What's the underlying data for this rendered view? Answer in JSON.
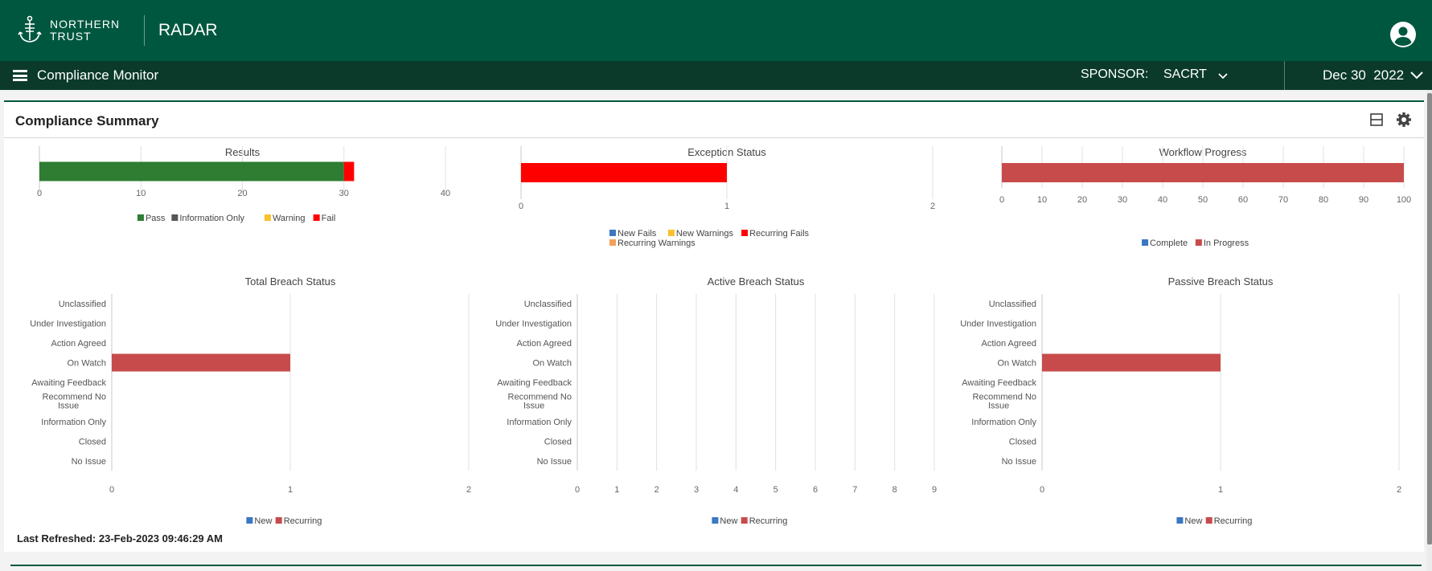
{
  "header": {
    "brand_line1": "NORTHERN",
    "brand_line2": "TRUST",
    "app_name": "RADAR",
    "logo_icon": "anchor-logo-icon",
    "avatar_icon": "user-circle-icon"
  },
  "nav": {
    "menu_icon": "hamburger-icon",
    "title": "Compliance Monitor",
    "sponsor_label": "SPONSOR:",
    "sponsor_value": "SACRT",
    "date_value": "Dec 30  2022"
  },
  "panel": {
    "title": "Compliance Summary",
    "actions": [
      "collapse-icon",
      "gear-icon"
    ],
    "last_refreshed": "Last Refreshed: 23-Feb-2023 09:46:29 AM"
  },
  "colors": {
    "header_bg": "#00573f",
    "nav_bg": "#0b3a2b",
    "pass": "#2e7d32",
    "info_only": "#555555",
    "warning": "#fbc02d",
    "fail": "#ff0000",
    "new": "#3a78c2",
    "recurring": "#c84b4b",
    "recurring_warnings": "#f4a05a"
  },
  "chart_data": [
    {
      "type": "bar",
      "orientation": "horizontal",
      "stacked": true,
      "title": "Results",
      "series": [
        {
          "name": "Pass",
          "values": [
            30
          ]
        },
        {
          "name": "Information Only",
          "values": [
            0
          ]
        },
        {
          "name": "Warning",
          "values": [
            0
          ]
        },
        {
          "name": "Fail",
          "values": [
            1
          ]
        }
      ],
      "xlim": [
        0,
        40
      ],
      "xticks": [
        "0",
        "10",
        "20",
        "30",
        "40"
      ],
      "legend": "bottom"
    },
    {
      "type": "bar",
      "orientation": "horizontal",
      "stacked": true,
      "title": "Exception Status",
      "series": [
        {
          "name": "New Fails",
          "values": [
            0
          ]
        },
        {
          "name": "New Warnings",
          "values": [
            0
          ]
        },
        {
          "name": "Recurring Fails",
          "values": [
            1
          ]
        },
        {
          "name": "Recurring Warnings",
          "values": [
            0
          ]
        }
      ],
      "xlim": [
        0,
        2
      ],
      "xticks": [
        "0",
        "1",
        "2"
      ],
      "legend": "bottom"
    },
    {
      "type": "bar",
      "orientation": "horizontal",
      "stacked": true,
      "title": "Workflow Progress",
      "series": [
        {
          "name": "Complete",
          "values": [
            0
          ]
        },
        {
          "name": "In Progress",
          "values": [
            100
          ]
        }
      ],
      "xlim": [
        0,
        100
      ],
      "xticks": [
        "0",
        "10",
        "20",
        "30",
        "40",
        "50",
        "60",
        "70",
        "80",
        "90",
        "100"
      ],
      "legend": "bottom"
    },
    {
      "type": "bar",
      "orientation": "horizontal",
      "stacked": true,
      "title": "Total Breach Status",
      "categories": [
        "Unclassified",
        "Under Investigation",
        "Action Agreed",
        "On Watch",
        "Awaiting Feedback",
        "Recommend No Issue",
        "Information Only",
        "Closed",
        "No Issue"
      ],
      "series": [
        {
          "name": "New",
          "values": [
            0,
            0,
            0,
            0,
            0,
            0,
            0,
            0,
            0
          ]
        },
        {
          "name": "Recurring",
          "values": [
            0,
            0,
            0,
            1,
            0,
            0,
            0,
            0,
            0
          ]
        }
      ],
      "xlim": [
        0,
        2
      ],
      "xticks": [
        "0",
        "1",
        "2"
      ],
      "legend": "bottom"
    },
    {
      "type": "bar",
      "orientation": "horizontal",
      "stacked": true,
      "title": "Active Breach Status",
      "categories": [
        "Unclassified",
        "Under Investigation",
        "Action Agreed",
        "On Watch",
        "Awaiting Feedback",
        "Recommend No Issue",
        "Information Only",
        "Closed",
        "No Issue"
      ],
      "series": [
        {
          "name": "New",
          "values": [
            0,
            0,
            0,
            0,
            0,
            0,
            0,
            0,
            0
          ]
        },
        {
          "name": "Recurring",
          "values": [
            0,
            0,
            0,
            0,
            0,
            0,
            0,
            0,
            0
          ]
        }
      ],
      "xlim": [
        0,
        9
      ],
      "xticks": [
        "0",
        "1",
        "2",
        "3",
        "4",
        "5",
        "6",
        "7",
        "8",
        "9"
      ],
      "legend": "bottom"
    },
    {
      "type": "bar",
      "orientation": "horizontal",
      "stacked": true,
      "title": "Passive Breach Status",
      "categories": [
        "Unclassified",
        "Under Investigation",
        "Action Agreed",
        "On Watch",
        "Awaiting Feedback",
        "Recommend No Issue",
        "Information Only",
        "Closed",
        "No Issue"
      ],
      "series": [
        {
          "name": "New",
          "values": [
            0,
            0,
            0,
            0,
            0,
            0,
            0,
            0,
            0
          ]
        },
        {
          "name": "Recurring",
          "values": [
            0,
            0,
            0,
            1,
            0,
            0,
            0,
            0,
            0
          ]
        }
      ],
      "xlim": [
        0,
        2
      ],
      "xticks": [
        "0",
        "1",
        "2"
      ],
      "legend": "bottom"
    }
  ]
}
